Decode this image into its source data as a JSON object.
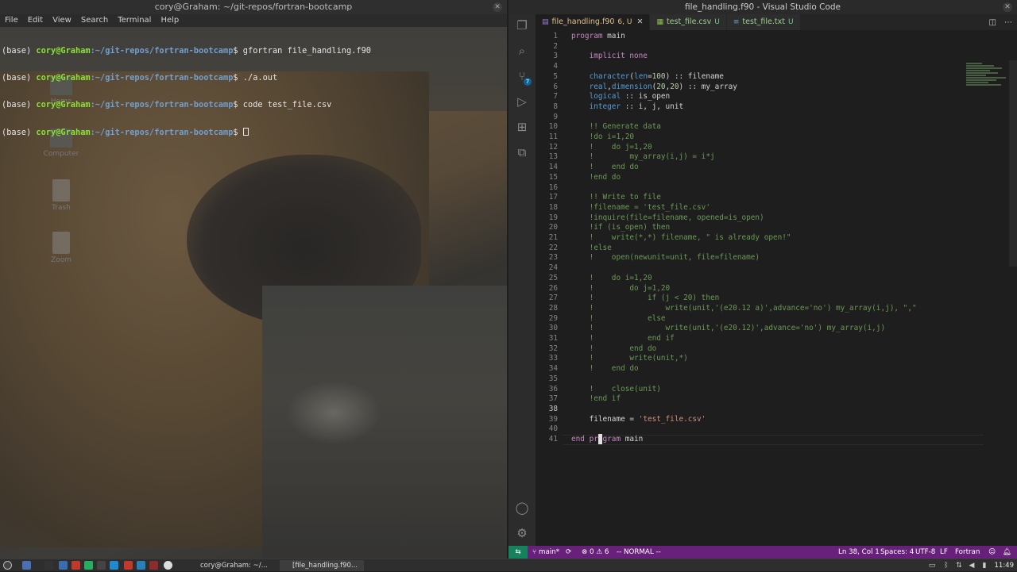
{
  "terminal": {
    "title": "cory@Graham: ~/git-repos/fortran-bootcamp",
    "menu": [
      "File",
      "Edit",
      "View",
      "Search",
      "Terminal",
      "Help"
    ],
    "lines": [
      {
        "env": "(base) ",
        "user": "cory@Graham",
        "path": ":~/git-repos/fortran-bootcamp",
        "cmd": "$ gfortran file_handling.f90"
      },
      {
        "env": "(base) ",
        "user": "cory@Graham",
        "path": ":~/git-repos/fortran-bootcamp",
        "cmd": "$ ./a.out"
      },
      {
        "env": "(base) ",
        "user": "cory@Graham",
        "path": ":~/git-repos/fortran-bootcamp",
        "cmd": "$ code test_file.csv"
      },
      {
        "env": "(base) ",
        "user": "cory@Graham",
        "path": ":~/git-repos/fortran-bootcamp",
        "cmd": "$ "
      }
    ],
    "desktop_icons": [
      "Home",
      "Computer",
      "Trash",
      "Zoom"
    ]
  },
  "vscode": {
    "title": "file_handling.f90 - Visual Studio Code",
    "tabs": [
      {
        "name": "file_handling.f90",
        "status": "6, U",
        "active": true
      },
      {
        "name": "test_file.csv",
        "status": "U",
        "active": false
      },
      {
        "name": "test_file.txt",
        "status": "U",
        "active": false
      }
    ],
    "badge": "7",
    "code": [
      "program main",
      "",
      "    implicit none",
      "",
      "    character(len=100) :: filename",
      "    real,dimension(20,20) :: my_array",
      "    logical :: is_open",
      "    integer :: i, j, unit",
      "",
      "    !! Generate data",
      "    !do i=1,20",
      "    !    do j=1,20",
      "    !        my_array(i,j) = i*j",
      "    !    end do",
      "    !end do",
      "",
      "    !! Write to file",
      "    !filename = 'test_file.csv'",
      "    !inquire(file=filename, opened=is_open)",
      "    !if (is_open) then",
      "    !    write(*,*) filename, \" is already open!\"",
      "    !else",
      "    !    open(newunit=unit, file=filename)",
      "",
      "    !    do i=1,20",
      "    !        do j=1,20",
      "    !            if (j < 20) then",
      "    !                write(unit,'(e20.12 a)',advance='no') my_array(i,j), \",\"",
      "    !            else",
      "    !                write(unit,'(e20.12)',advance='no') my_array(i,j)",
      "    !            end if",
      "    !        end do",
      "    !        write(unit,*)",
      "    !    end do",
      "",
      "    !    close(unit)",
      "    !end if",
      "",
      "    filename = 'test_file.csv'",
      "",
      "end program main"
    ],
    "current_line": 38,
    "status": {
      "branch": "main*",
      "problems": "⊗ 0 ⚠ 6",
      "mode": "-- NORMAL --",
      "position": "Ln 38, Col 1",
      "spaces": "Spaces: 4",
      "encoding": "UTF-8",
      "eol": "LF",
      "language": "Fortran"
    }
  },
  "taskbar": {
    "windows": [
      "cory@Graham: ~/...",
      "[file_handling.f90..."
    ],
    "clock": "11:49"
  },
  "colors": {
    "status_bar": "#68217a",
    "remote": "#16825d",
    "comment": "#6a9955",
    "string": "#ce9178",
    "keyword": "#c586c0"
  }
}
